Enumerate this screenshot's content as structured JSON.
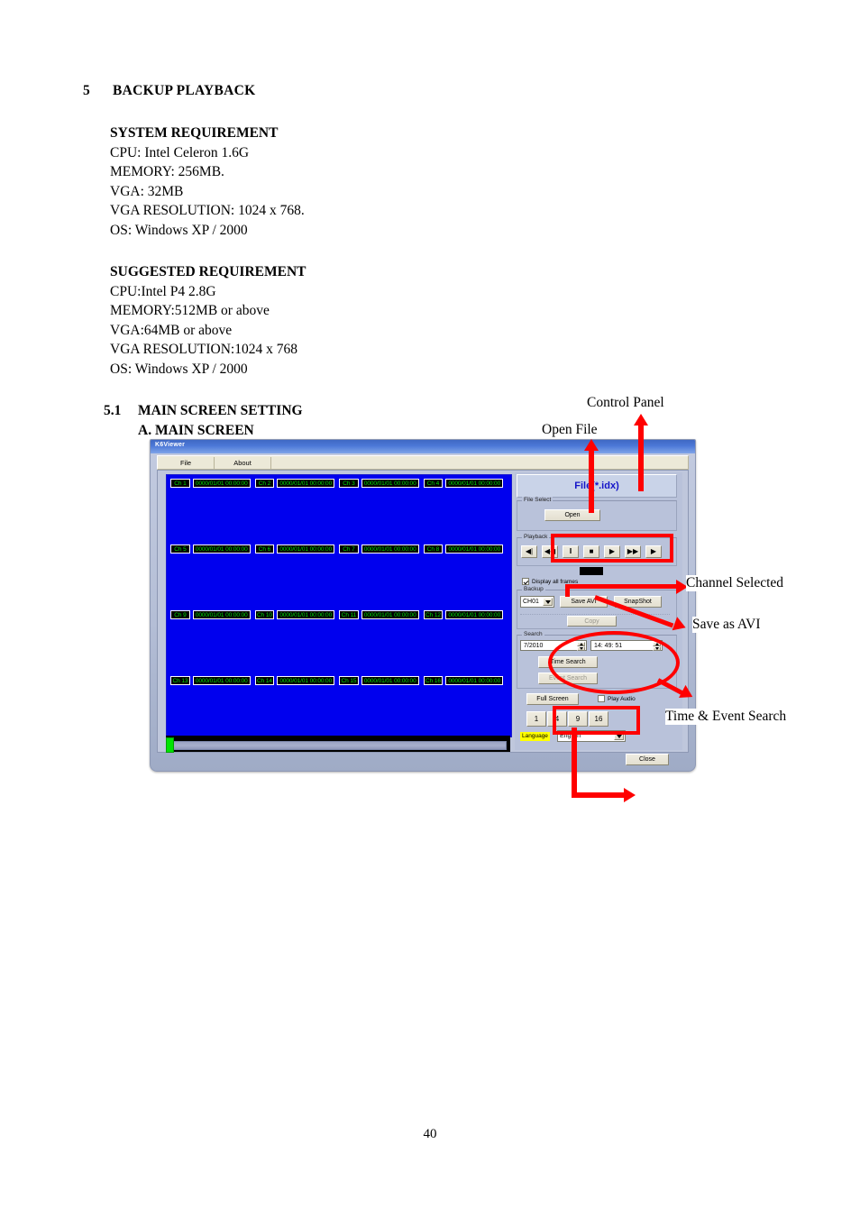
{
  "document": {
    "chapter_number": "5",
    "chapter_title": "BACKUP PLAYBACK",
    "system_requirement": {
      "heading": "SYSTEM REQUIREMENT",
      "lines": [
        "CPU: Intel Celeron 1.6G",
        "MEMORY: 256MB.",
        "VGA: 32MB",
        "VGA RESOLUTION: 1024 x 768.",
        "OS: Windows XP / 2000"
      ]
    },
    "suggested_requirement": {
      "heading": "SUGGESTED REQUIREMENT",
      "lines": [
        "CPU:Intel P4 2.8G",
        "MEMORY:512MB or above",
        "VGA:64MB or above",
        "VGA RESOLUTION:1024 x 768",
        "OS: Windows XP / 2000"
      ]
    },
    "section_number": "5.1",
    "section_title": "MAIN SCREEN SETTING",
    "subsection_title": "A. MAIN SCREEN",
    "page_number": "40"
  },
  "annotations": {
    "accent_color": "#ff0000",
    "control_panel": "Control Panel",
    "open_file": "Open File",
    "channel_selected": "Channel Selected",
    "save_as_avi": "Save as AVI",
    "time_event_search": "Time & Event Search"
  },
  "app": {
    "title": "K6Viewer",
    "menu": [
      "File",
      "About"
    ],
    "video": {
      "background_color": "#0000ee",
      "rows": [
        [
          {
            "channel": "Ch 1",
            "timestamp": "0000/01/01  00:00:00"
          },
          {
            "channel": "Ch 2",
            "timestamp": "0000/01/01  00:00:00"
          },
          {
            "channel": "Ch 3",
            "timestamp": "0000/01/01  00:00:00"
          },
          {
            "channel": "Ch 4",
            "timestamp": "0000/01/01  00:00:00"
          }
        ],
        [
          {
            "channel": "Ch 5",
            "timestamp": "0000/01/01  00:00:00"
          },
          {
            "channel": "Ch 6",
            "timestamp": "0000/01/01  00:00:00"
          },
          {
            "channel": "Ch 7",
            "timestamp": "0000/01/01  00:00:00"
          },
          {
            "channel": "Ch 8",
            "timestamp": "0000/01/01  00:00:00"
          }
        ],
        [
          {
            "channel": "Ch 9",
            "timestamp": "0000/01/01  00:00:00"
          },
          {
            "channel": "Ch 10",
            "timestamp": "0000/01/01  00:00:00"
          },
          {
            "channel": "Ch 11",
            "timestamp": "0000/01/01  00:00:00"
          },
          {
            "channel": "Ch 12",
            "timestamp": "0000/01/01  00:00:00"
          }
        ],
        [
          {
            "channel": "Ch 13",
            "timestamp": "0000/01/01  00:00:00"
          },
          {
            "channel": "Ch 14",
            "timestamp": "0000/01/01  00:00:00"
          },
          {
            "channel": "Ch 15",
            "timestamp": "0000/01/01  00:00:00"
          },
          {
            "channel": "Ch 16",
            "timestamp": "0000/01/01  00:00:00"
          }
        ]
      ]
    },
    "panel": {
      "title": "File(*.idx)",
      "file_select": {
        "group_label": "File Select",
        "open_label": "Open"
      },
      "playback": {
        "group_label": "Playback",
        "buttons": [
          {
            "name": "step-back-icon",
            "glyph": "◀|"
          },
          {
            "name": "rewind-icon",
            "glyph": "◀◀"
          },
          {
            "name": "pause-icon",
            "glyph": "‖"
          },
          {
            "name": "stop-icon",
            "glyph": "■"
          },
          {
            "name": "play-icon",
            "glyph": "▶"
          },
          {
            "name": "fast-forward-icon",
            "glyph": "▶▶"
          },
          {
            "name": "step-forward-icon",
            "glyph": "▶"
          }
        ]
      },
      "display_all_frames": {
        "label": "Display all frames",
        "checked": true
      },
      "backup": {
        "group_label": "Backup",
        "channel_value": "CH01",
        "save_avi_label": "Save AVI",
        "snapshot_label": "SnapShot",
        "copy_label": "Copy",
        "copy_enabled": false
      },
      "search": {
        "group_label": "Search",
        "date_value": "7/2010",
        "time_value": "14: 49: 51",
        "time_search_label": "Time Search",
        "event_search_label": "Event Search",
        "event_search_enabled": false
      },
      "full_screen_label": "Full Screen",
      "play_audio": {
        "label": "Play Audio",
        "checked": false
      },
      "split_buttons": [
        "1",
        "4",
        "9",
        "16"
      ],
      "language": {
        "label": "Language",
        "value": "English"
      },
      "close_label": "Close"
    }
  }
}
